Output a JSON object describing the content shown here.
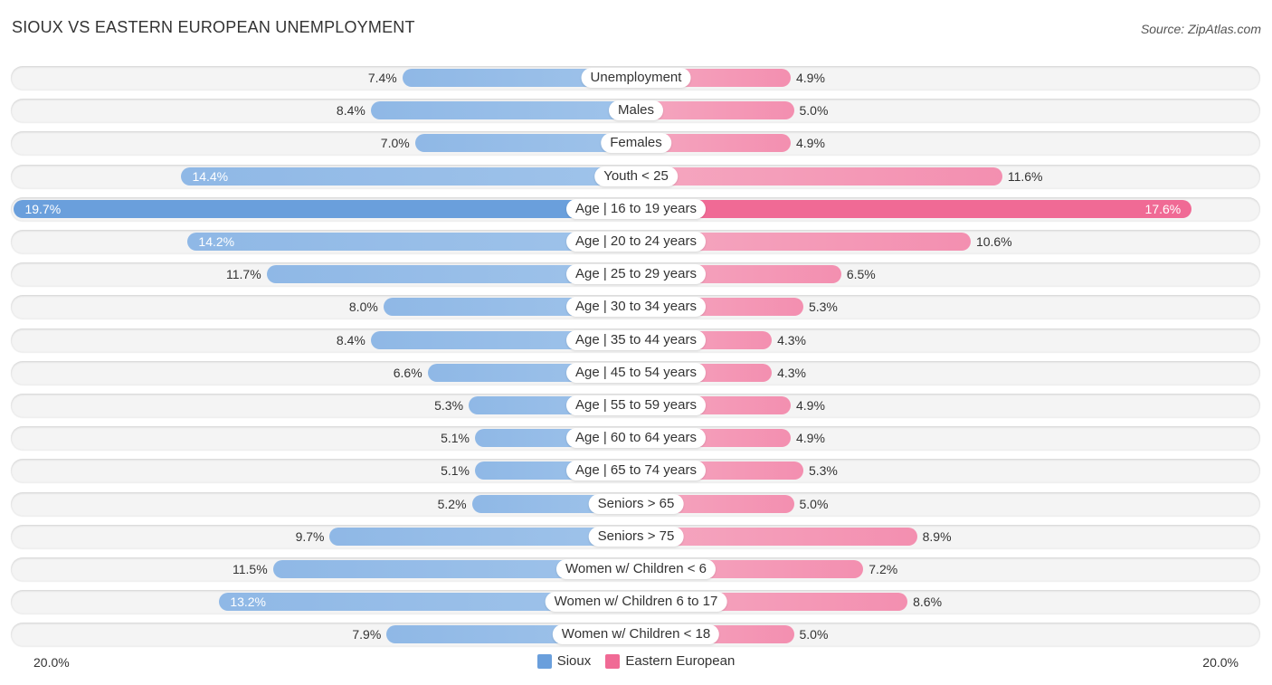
{
  "title": "SIOUX VS EASTERN EUROPEAN UNEMPLOYMENT",
  "source": "Source: ZipAtlas.com",
  "chart_data": {
    "type": "bar",
    "orientation": "diverging-horizontal",
    "title": "SIOUX VS EASTERN EUROPEAN UNEMPLOYMENT",
    "categories": [
      "Unemployment",
      "Males",
      "Females",
      "Youth < 25",
      "Age | 16 to 19 years",
      "Age | 20 to 24 years",
      "Age | 25 to 29 years",
      "Age | 30 to 34 years",
      "Age | 35 to 44 years",
      "Age | 45 to 54 years",
      "Age | 55 to 59 years",
      "Age | 60 to 64 years",
      "Age | 65 to 74 years",
      "Seniors > 65",
      "Seniors > 75",
      "Women w/ Children < 6",
      "Women w/ Children 6 to 17",
      "Women w/ Children < 18"
    ],
    "series": [
      {
        "name": "Sioux",
        "color": "#6a9fdc",
        "side": "left",
        "values": [
          7.4,
          8.4,
          7.0,
          14.4,
          19.7,
          14.2,
          11.7,
          8.0,
          8.4,
          6.6,
          5.3,
          5.1,
          5.1,
          5.2,
          9.7,
          11.5,
          13.2,
          7.9
        ]
      },
      {
        "name": "Eastern European",
        "color": "#f06a95",
        "side": "right",
        "values": [
          4.9,
          5.0,
          4.9,
          11.6,
          17.6,
          10.6,
          6.5,
          5.3,
          4.3,
          4.3,
          4.9,
          4.9,
          5.3,
          5.0,
          8.9,
          7.2,
          8.6,
          5.0
        ]
      }
    ],
    "value_suffix": "%",
    "xlim": [
      -20,
      20
    ],
    "axis_min_label": "20.0%",
    "axis_max_label": "20.0%",
    "legend_position": "bottom-center",
    "grid": false
  }
}
